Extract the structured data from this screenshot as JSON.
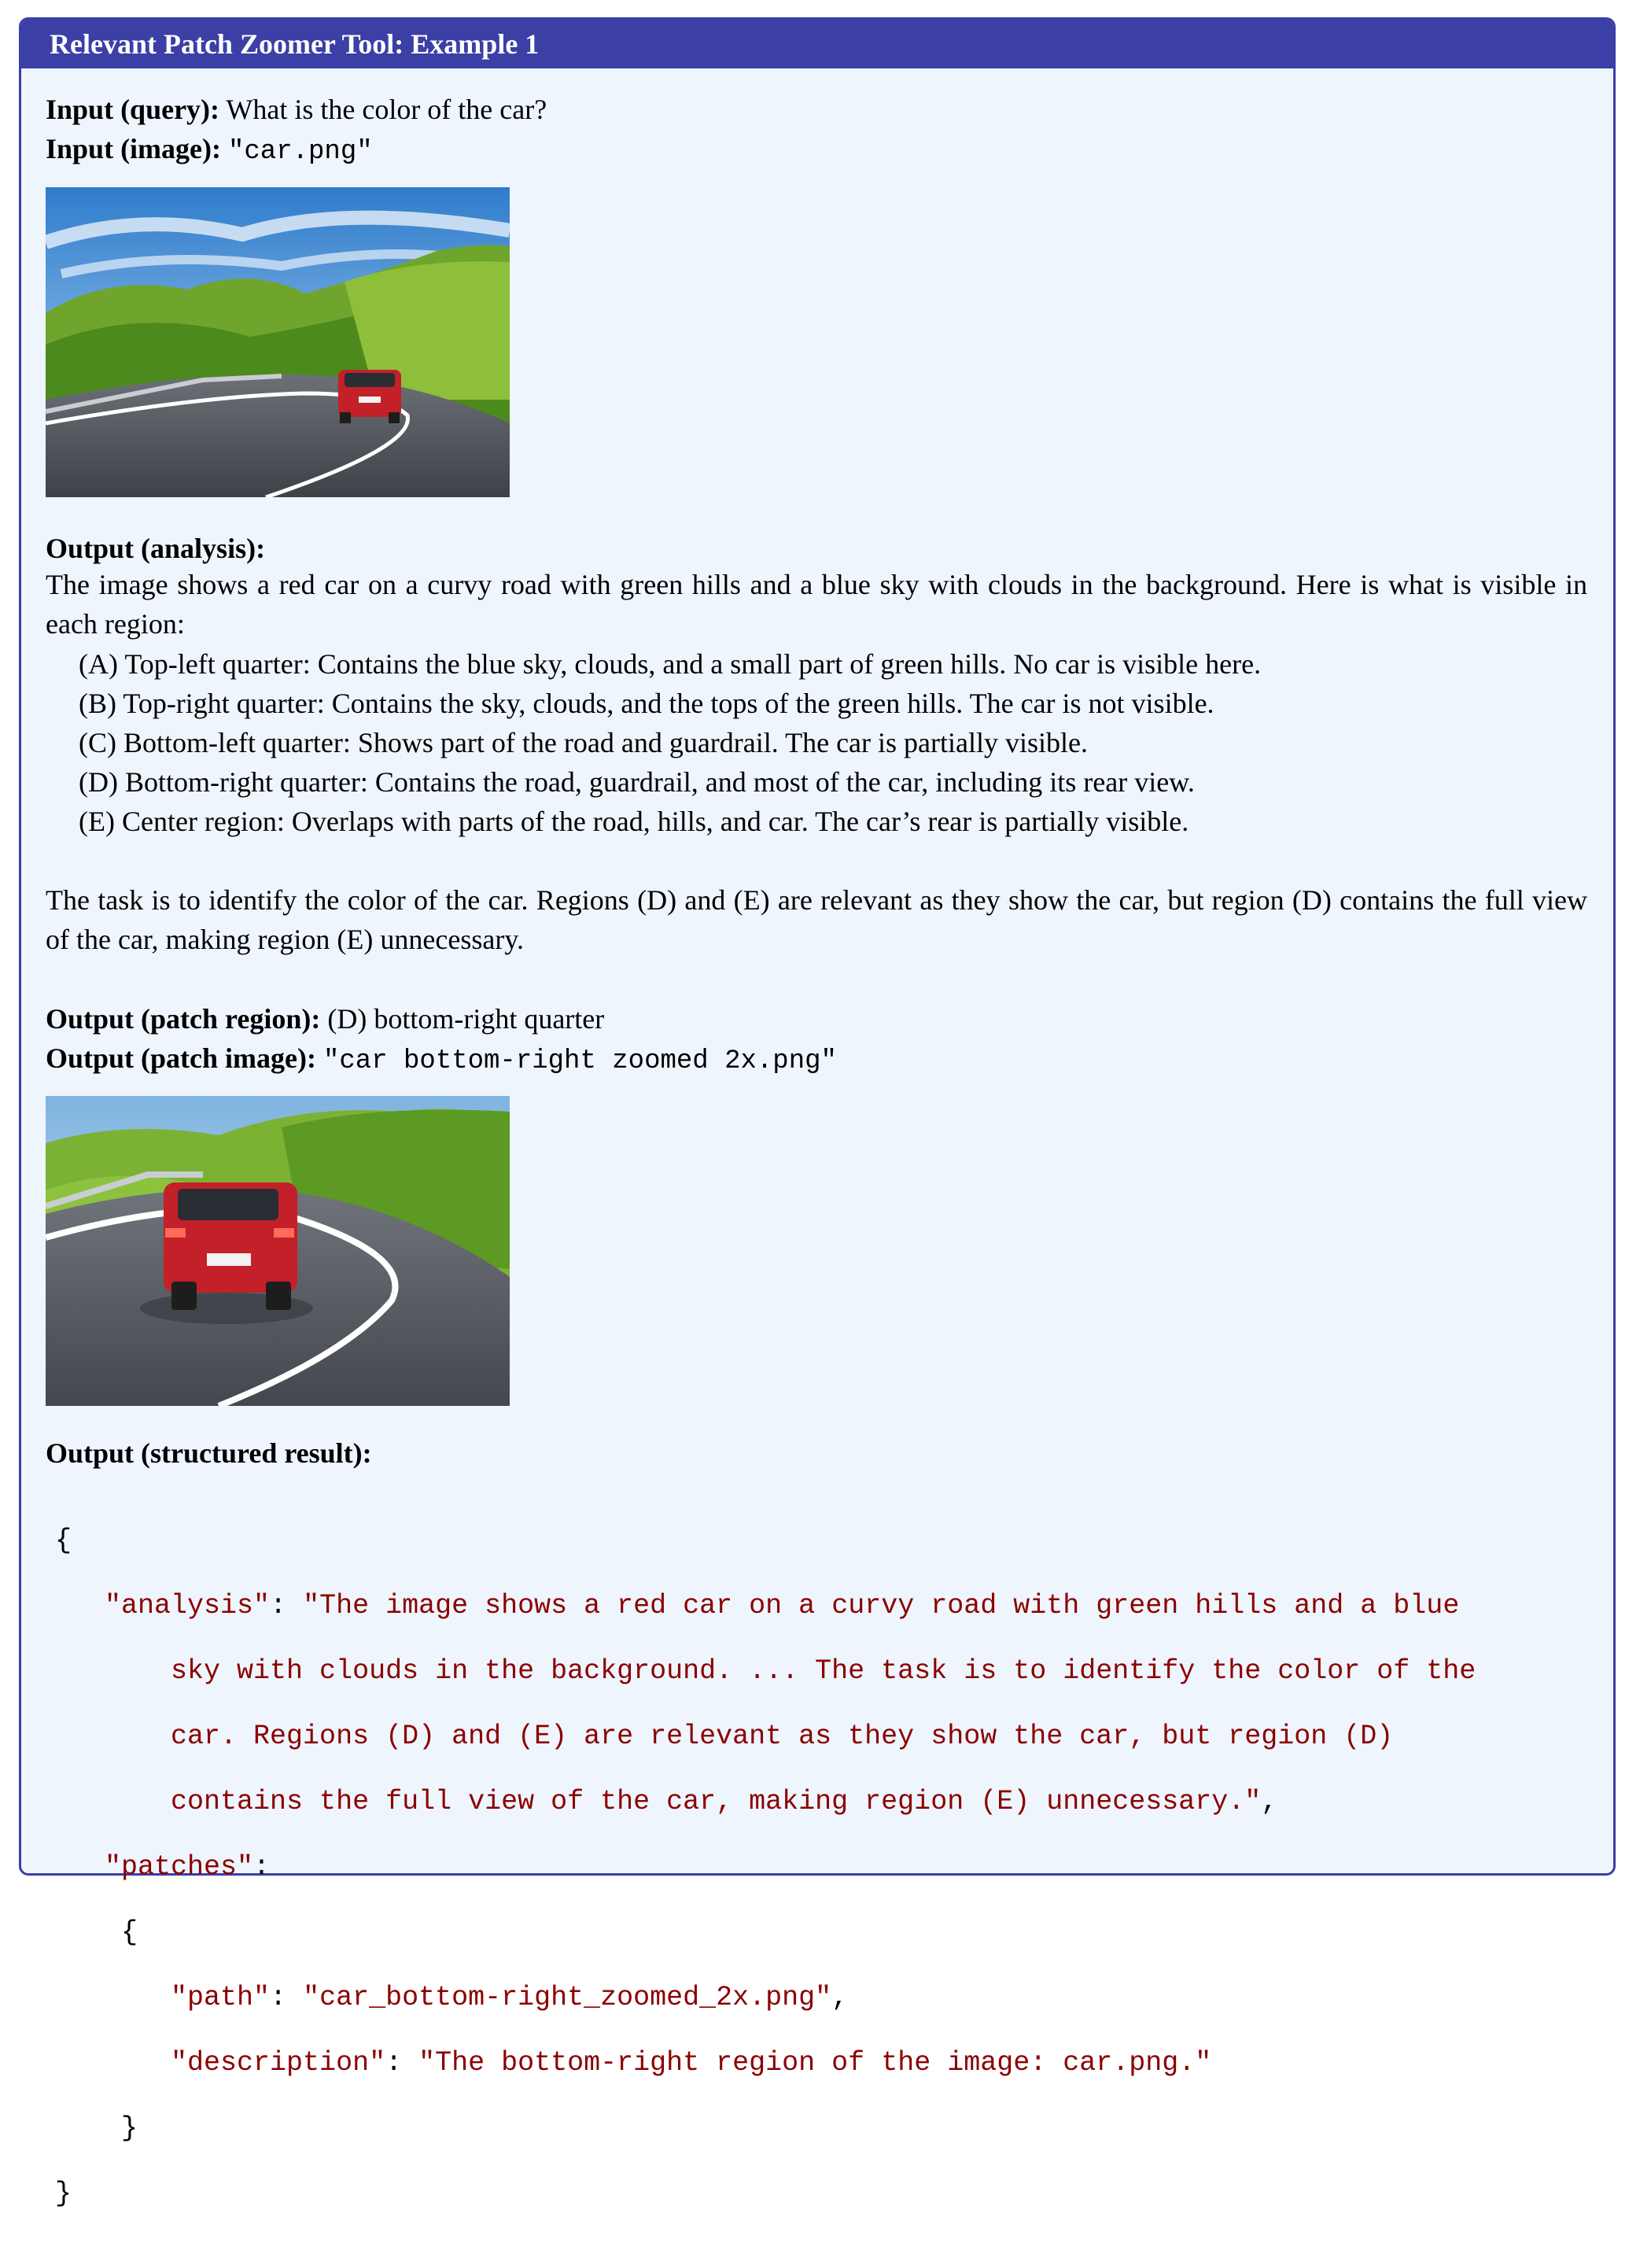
{
  "header": {
    "title": "Relevant Patch Zoomer Tool: Example 1"
  },
  "input": {
    "query_label": "Input (query):",
    "query_text": "What is the color of the car?",
    "image_label": "Input (image):",
    "image_name": "\"car.png\""
  },
  "analysis": {
    "label": "Output (analysis):",
    "intro": "The image shows a red car on a curvy road with green hills and a blue sky with clouds in the background. Here is what is visible in each region:",
    "regions": [
      "(A) Top-left quarter: Contains the blue sky, clouds, and a small part of green hills. No car is visible here.",
      "(B) Top-right quarter: Contains the sky, clouds, and the tops of the green hills. The car is not visible.",
      "(C) Bottom-left quarter: Shows part of the road and guardrail. The car is partially visible.",
      "(D) Bottom-right quarter: Contains the road, guardrail, and most of the car, including its rear view.",
      "(E) Center region: Overlaps with parts of the road, hills, and car. The car’s rear is partially visible."
    ],
    "conclusion": "The task is to identify the color of the car.  Regions (D) and (E) are relevant as they show the car, but region (D) contains the full view of the car, making region (E) unnecessary."
  },
  "patch": {
    "region_label": "Output (patch region):",
    "region_value": "(D) bottom-right quarter",
    "image_label": "Output (patch image):",
    "image_name": "\"car bottom-right zoomed 2x.png\""
  },
  "structured": {
    "label": "Output (structured result):",
    "open_brace": "{",
    "analysis_key": "\"analysis\"",
    "colon": ": ",
    "analysis_lines": [
      "\"The image shows a red car on a curvy road with green hills and a blue",
      "sky with clouds in the background. ... The task is to identify the color of the",
      "car. Regions (D) and (E) are relevant as they show the car, but region (D)",
      "contains the full view of the car, making region (E) unnecessary.\""
    ],
    "comma": ",",
    "patches_key": "\"patches\"",
    "patches_colon": ":",
    "inner_open": "{",
    "path_key": "\"path\"",
    "path_value": "\"car_bottom-right_zoomed_2x.png\"",
    "desc_key": "\"description\"",
    "desc_value": "\"The bottom-right region of the image: car.png.\"",
    "inner_close": "}",
    "close_brace": "}"
  },
  "colors": {
    "frame": "#3b3fa6",
    "background": "#eef5fd",
    "code_string": "#8b0000"
  }
}
